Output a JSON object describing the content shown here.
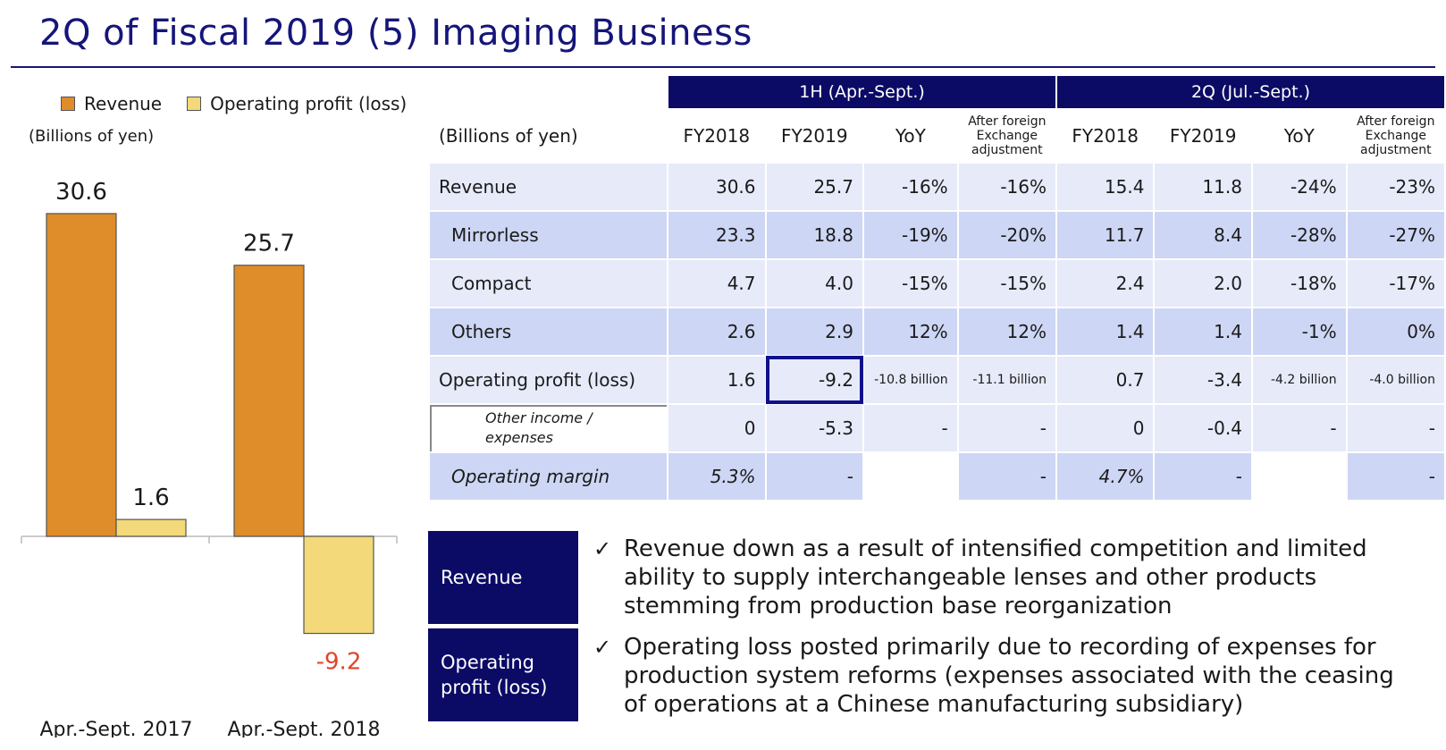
{
  "title": "2Q of Fiscal 2019 (5) Imaging Business",
  "colors": {
    "revenue": "#df8c2a",
    "profit": "#f3d97a",
    "negative_label": "#e0452a",
    "navy": "#0b0b66"
  },
  "chart_data": {
    "type": "bar",
    "categories": [
      "Apr.-Sept. 2017",
      "Apr.-Sept. 2018"
    ],
    "series": [
      {
        "name": "Revenue",
        "values": [
          30.6,
          25.7
        ]
      },
      {
        "name": "Operating profit (loss)",
        "values": [
          1.6,
          -9.2
        ]
      }
    ],
    "units": "(Billions of yen)",
    "value_labels": {
      "revenue": [
        "30.6",
        "25.7"
      ],
      "profit": [
        "1.6",
        "-9.2"
      ]
    },
    "legend_position": "top"
  },
  "table": {
    "group_1h": "1H (Apr.-Sept.)",
    "group_2q": "2Q (Jul.-Sept.)",
    "units": "(Billions of yen)",
    "columns": [
      "FY2018",
      "FY2019",
      "YoY",
      "After foreign Exchange adjustment",
      "FY2018",
      "FY2019",
      "YoY",
      "After foreign Exchange adjustment"
    ],
    "rows": [
      {
        "label": "Revenue",
        "cells": [
          "30.6",
          "25.7",
          "-16%",
          "-16%",
          "15.4",
          "11.8",
          "-24%",
          "-23%"
        ]
      },
      {
        "label": "Mirrorless",
        "cells": [
          "23.3",
          "18.8",
          "-19%",
          "-20%",
          "11.7",
          "8.4",
          "-28%",
          "-27%"
        ]
      },
      {
        "label": "Compact",
        "cells": [
          "4.7",
          "4.0",
          "-15%",
          "-15%",
          "2.4",
          "2.0",
          "-18%",
          "-17%"
        ]
      },
      {
        "label": "Others",
        "cells": [
          "2.6",
          "2.9",
          "12%",
          "12%",
          "1.4",
          "1.4",
          "-1%",
          "0%"
        ]
      },
      {
        "label": "Operating profit (loss)",
        "cells": [
          "1.6",
          "-9.2",
          "-10.8 billion",
          "-11.1 billion",
          "0.7",
          "-3.4",
          "-4.2 billion",
          "-4.0 billion"
        ]
      },
      {
        "label": "Other income / expenses",
        "cells": [
          "0",
          "-5.3",
          "-",
          "-",
          "0",
          "-0.4",
          "-",
          "-"
        ]
      },
      {
        "label": "Operating margin",
        "cells": [
          "5.3%",
          "-",
          "",
          "-",
          "4.7%",
          "-",
          "",
          "-"
        ]
      }
    ]
  },
  "notes": [
    {
      "label": "Revenue",
      "text": "Revenue down as a result of intensified competition and limited ability to supply interchangeable lenses and other products stemming from production base reorganization"
    },
    {
      "label": "Operating profit (loss)",
      "text": "Operating loss posted primarily due to recording of expenses for production system reforms (expenses associated with the ceasing of operations at a Chinese manufacturing subsidiary)"
    }
  ],
  "check_glyph": "✓"
}
